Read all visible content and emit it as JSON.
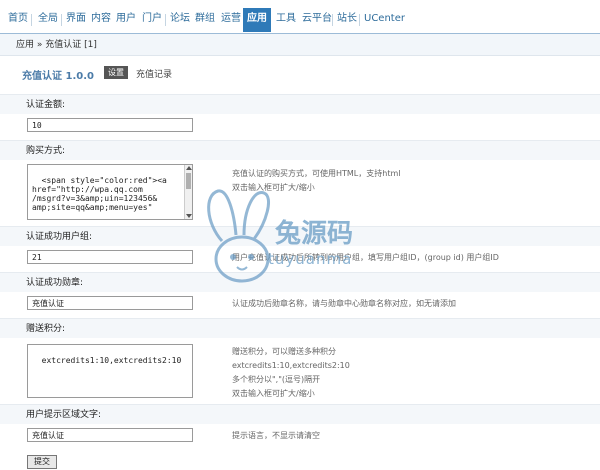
{
  "nav": {
    "tabs": [
      {
        "label": "首页",
        "active": false
      },
      {
        "label": "全局",
        "active": false
      },
      {
        "label": "界面",
        "active": false
      },
      {
        "label": "内容",
        "active": false
      },
      {
        "label": "用户",
        "active": false
      },
      {
        "label": "门户",
        "active": false
      },
      {
        "label": "论坛",
        "active": false
      },
      {
        "label": "群组",
        "active": false
      },
      {
        "label": "运营",
        "active": false
      },
      {
        "label": "应用",
        "active": true
      },
      {
        "label": "工具",
        "active": false
      },
      {
        "label": "云平台",
        "active": false
      },
      {
        "label": "站长",
        "active": false
      },
      {
        "label": "UCenter",
        "active": false
      }
    ],
    "active_color": "#2f7ab8"
  },
  "breadcrumb": "应用 » 充值认证 [1]",
  "plugin": {
    "title": "充值认证 1.0.0",
    "badge": "设置",
    "subtitle": "充值记录"
  },
  "form": {
    "amount_label": "认证金额:",
    "amount_value": "10",
    "method_label": "购买方式:",
    "method_value": "<span style=\"color:red\"><a\nhref=\"http://wpa.qq.com\n/msgrd?v=3&amp;uin=123456&\namp;site=qq&amp;menu=yes\"",
    "method_tip_line1": "充值认证的购买方式，可使用HTML，支持html",
    "method_tip_line2": "双击输入框可扩大/缩小",
    "group_label": "认证成功用户组:",
    "group_value": "21",
    "group_tip": "用户充值认证成功后所转到的用户组，填写用户组ID，(group id) 用户组ID",
    "medal_label": "认证成功勋章:",
    "medal_value": "充值认证",
    "medal_tip": "认证成功后勋章名称，请与勋章中心勋章名称对应，如无请添加",
    "credits_label": "赠送积分:",
    "credits_value": "extcredits1:10,extcredits2:10",
    "credits_tip_line1": "赠送积分，可以赠送多种积分",
    "credits_tip_line2": "extcredits1:10,extcredits2:10",
    "credits_tip_line3": "多个积分以\",\"(逗号)隔开",
    "credits_tip_line4": "双击输入框可扩大/缩小",
    "display_label": "用户提示区域文字:",
    "display_value": "充值认证",
    "display_tip": "提示语言，不显示请清空",
    "submit_label": "提交"
  },
  "watermark": {
    "text": "兔源码",
    "sub": "tuyuanma"
  }
}
